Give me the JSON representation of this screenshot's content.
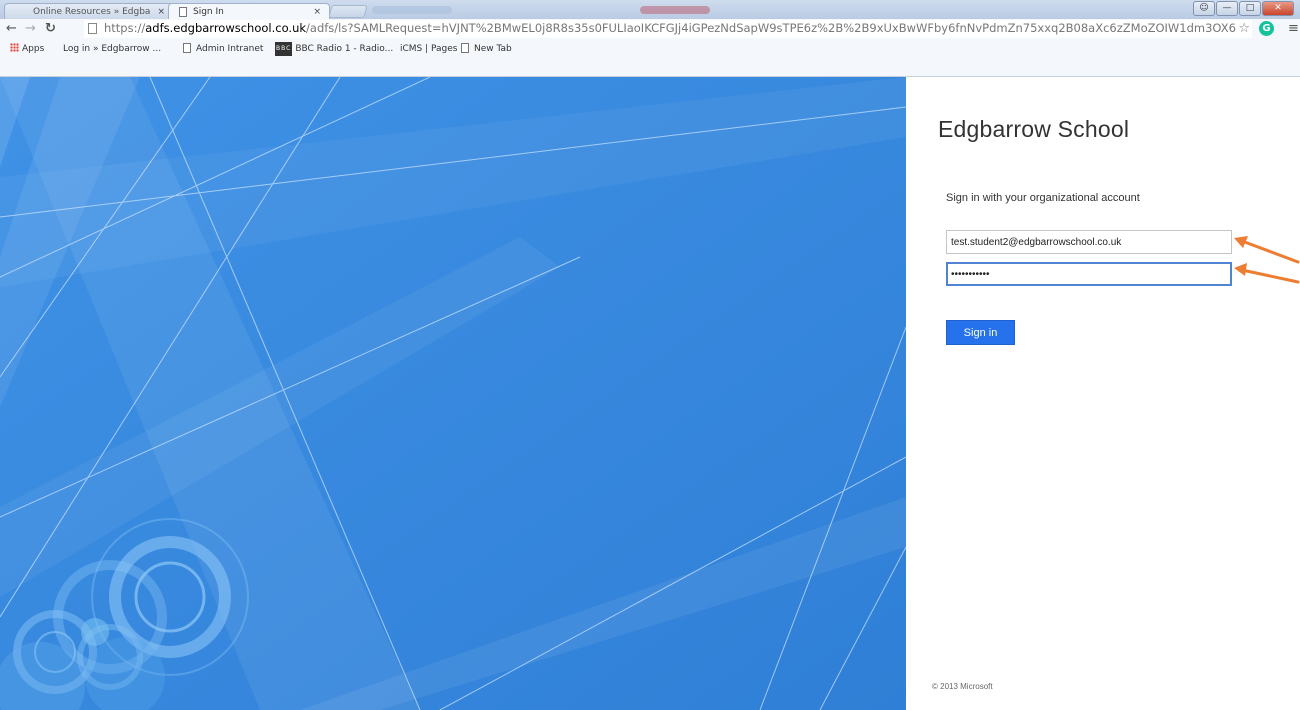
{
  "browser": {
    "tabs": [
      {
        "label": "Online Resources » Edgba",
        "close": "×",
        "active": false
      },
      {
        "label": "Sign In",
        "close": "×",
        "active": true
      }
    ],
    "url": {
      "scheme": "https://",
      "host": "adfs.edgbarrowschool.co.uk",
      "rest": "/adfs/ls?SAMLRequest=hVJNT%2BMwEL0j8R8s35s0FULIaoIKCFGJj4iGPezNdSapW9sTPE6z%2B%2B9xUxBwWFby6fnNvPdmZn75xxq2B08aXc6zZMoZOIW1dm3OX6"
    },
    "bookmarks": [
      {
        "icon": "apps-icon",
        "label": "Apps"
      },
      {
        "icon": "",
        "label": "Log in » Edgbarrow ..."
      },
      {
        "icon": "page-icon",
        "label": "Admin Intranet"
      },
      {
        "icon": "bbc-icon",
        "label": "BBC Radio 1 - Radio..."
      },
      {
        "icon": "",
        "label": "iCMS | Pages"
      },
      {
        "icon": "page-icon",
        "label": "New Tab"
      }
    ],
    "extension_letter": "G"
  },
  "colors": {
    "background_blue": "#3a8ae0",
    "button_blue": "#2672ec",
    "arrow_orange": "#ed7d31"
  },
  "signin": {
    "organization": "Edgbarrow School",
    "prompt": "Sign in with your organizational account",
    "username_value": "test.student2@edgbarrowschool.co.uk",
    "password_value": "•••••••••••",
    "button_label": "Sign in",
    "footer": "© 2013 Microsoft"
  }
}
